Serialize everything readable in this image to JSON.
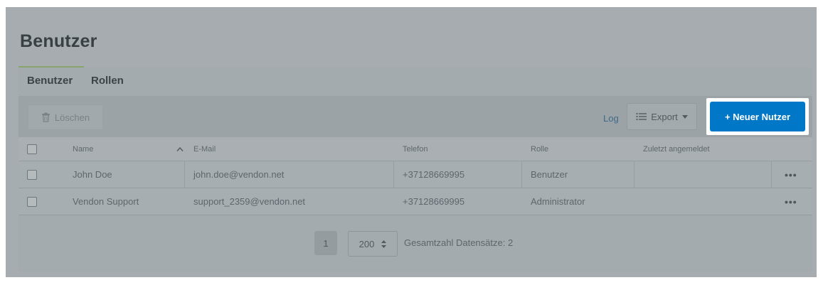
{
  "page": {
    "title": "Benutzer"
  },
  "tabs": [
    {
      "label": "Benutzer",
      "active": true
    },
    {
      "label": "Rollen",
      "active": false
    }
  ],
  "toolbar": {
    "delete_label": "Löschen",
    "log_label": "Log",
    "export_label": "Export",
    "new_user_label": "+ Neuer Nutzer"
  },
  "table": {
    "headers": {
      "name": "Name",
      "email": "E-Mail",
      "phone": "Telefon",
      "role": "Rolle",
      "last_login": "Zuletzt angemeldet"
    },
    "rows": [
      {
        "name": "John Doe",
        "email": "john.doe@vendon.net",
        "phone": "+37128669995",
        "role": "Benutzer",
        "last_login": "",
        "actions": "•••"
      },
      {
        "name": "Vendon Support",
        "email": "support_2359@vendon.net",
        "phone": "+37128669995",
        "role": "Administrator",
        "last_login": "",
        "actions": "•••"
      }
    ]
  },
  "pagination": {
    "current_page": "1",
    "page_size": "200",
    "total_label": "Gesamtzahl Datensätze: 2"
  },
  "colors": {
    "accent": "#0077c7",
    "tab_underline": "#8ba36d",
    "overlay": "#a6acaf"
  },
  "icons": {
    "delete": "trash-icon",
    "export": "list-icon",
    "dropdown": "caret-down-icon",
    "sort": "chevron-up-icon",
    "stepper": "updown-icon"
  }
}
